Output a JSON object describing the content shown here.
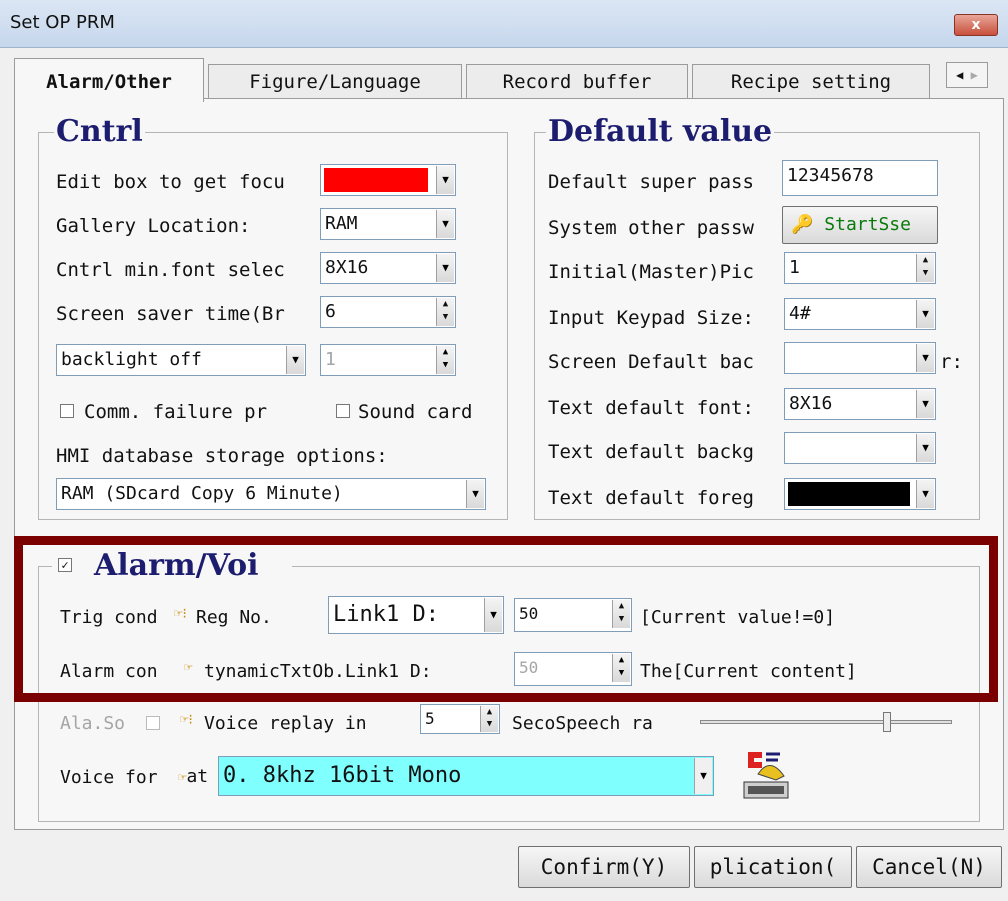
{
  "window": {
    "title": "Set OP PRM",
    "close": "x"
  },
  "tabs": [
    "Alarm/Other",
    "Figure/Language",
    "Record buffer",
    "Recipe setting"
  ],
  "tab_scroll": {
    "left": "◀",
    "right": "▶"
  },
  "cntrl": {
    "title": "Cntrl",
    "edit_focus_label": "Edit box to get focu",
    "edit_focus_color": "#ff0000",
    "gallery_label": "Gallery Location:",
    "gallery_value": "RAM",
    "minfont_label": "Cntrl min.font selec",
    "minfont_value": "8X16",
    "saver_label": "Screen saver time(Br",
    "saver_value": "6",
    "backlight_value": "backlight off",
    "backlight_num": "1",
    "comm_failure": "Comm. failure pr",
    "sound_card": "Sound card",
    "db_label": "HMI database storage options:",
    "db_value": "RAM (SDcard Copy 6 Minute)"
  },
  "defaults": {
    "title": "Default value",
    "super_pass_label": "Default super pass",
    "super_pass_value": "12345678",
    "other_pass_label": "System other passw",
    "other_pass_btn": "StartSse",
    "initial_pic_label": "Initial(Master)Pic",
    "initial_pic_value": "1",
    "keypad_label": "Input Keypad Size:",
    "keypad_value": "4#",
    "screen_bg_label": "Screen Default bac",
    "screen_bg_suffix": "r:",
    "text_font_label": "Text default font:",
    "text_font_value": "8X16",
    "text_bg_label": "Text default backg",
    "text_fg_label": "Text default foreg",
    "text_fg_color": "#000000"
  },
  "alarm": {
    "title": "Alarm/Voi",
    "checked": "✓",
    "trig_label": "Trig cond",
    "reg_label": "Reg No.",
    "reg_value": "Link1 D:",
    "reg_num": "50",
    "trig_cond": "[Current value!=0]",
    "content_label": "Alarm con",
    "content_text": "tynamicTxtOb.Link1 D:",
    "content_num": "50",
    "content_suffix": "The[Current content]",
    "sound_label": "Ala.So",
    "voice_replay_label": "Voice replay in",
    "voice_replay_value": "5",
    "speech_label": "SecoSpeech ra",
    "speech_rate": 0.75,
    "voice_format_label": "Voice for",
    "voice_format_hand": "at",
    "voice_format_value": "0. 8khz  16bit Mono"
  },
  "buttons": {
    "confirm": "Confirm(Y)",
    "apply": "plication(",
    "cancel": "Cancel(N)"
  },
  "colors": {
    "highlight_box": "#7b0000",
    "voice_format_bg": "#80ffff"
  }
}
